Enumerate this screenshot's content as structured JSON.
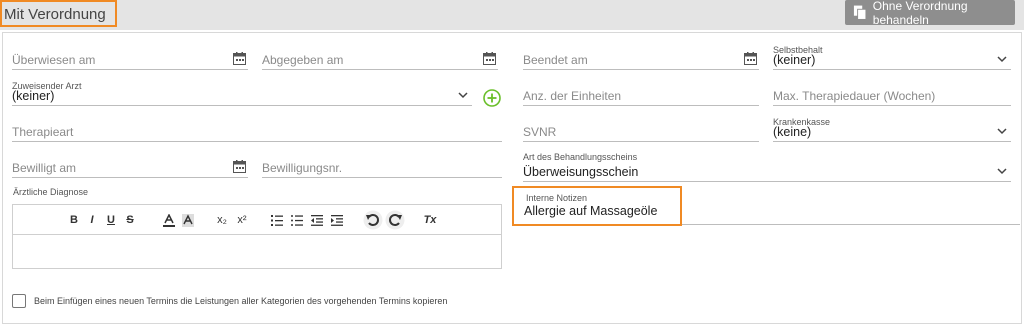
{
  "header": {
    "title": "Mit Verordnung",
    "no_prescription_button": "Ohne Verordnung behandeln"
  },
  "fields": {
    "referred_on": {
      "placeholder": "Überwiesen am"
    },
    "handed_in_on": {
      "placeholder": "Abgegeben am"
    },
    "ended_on": {
      "placeholder": "Beendet am"
    },
    "deductible": {
      "label": "Selbstbehalt",
      "value": "(keiner)"
    },
    "referring_doctor": {
      "label": "Zuweisender Arzt",
      "value": "(keiner)"
    },
    "units_count": {
      "placeholder": "Anz. der Einheiten"
    },
    "max_therapy_duration": {
      "placeholder": "Max. Therapiedauer (Wochen)"
    },
    "therapy_type": {
      "placeholder": "Therapieart"
    },
    "svnr": {
      "placeholder": "SVNR"
    },
    "health_insurance": {
      "label": "Krankenkasse",
      "value": "(keine)"
    },
    "approved_on": {
      "placeholder": "Bewilligt am"
    },
    "approval_number": {
      "placeholder": "Bewilligungsnr."
    },
    "treatment_certificate_type": {
      "label": "Art des Behandlungsscheins",
      "value": "Überweisungsschein"
    },
    "medical_diagnosis": {
      "label": "Ärztliche Diagnose"
    },
    "internal_notes": {
      "label": "Interne Notizen",
      "value": "Allergie auf Massageöle"
    }
  },
  "editor_toolbar": {
    "bold": "B",
    "italic": "I",
    "underline": "U",
    "strike": "S",
    "subscript": "x₂",
    "superscript": "x²",
    "clear_format": "Tx"
  },
  "copy_option": {
    "label": "Beim Einfügen eines neuen Termins die Leistungen aller Kategorien des vorgehenden Termins kopieren",
    "checked": false
  },
  "colors": {
    "highlight": "#f08a24",
    "add_icon": "#6abf2a",
    "topbar": "#e4e4e4",
    "button": "#8e8e8e"
  },
  "icons": [
    "calendar-icon",
    "chevron-down-icon",
    "plus-circle-icon",
    "document-copy-icon",
    "undo-icon",
    "redo-icon"
  ]
}
